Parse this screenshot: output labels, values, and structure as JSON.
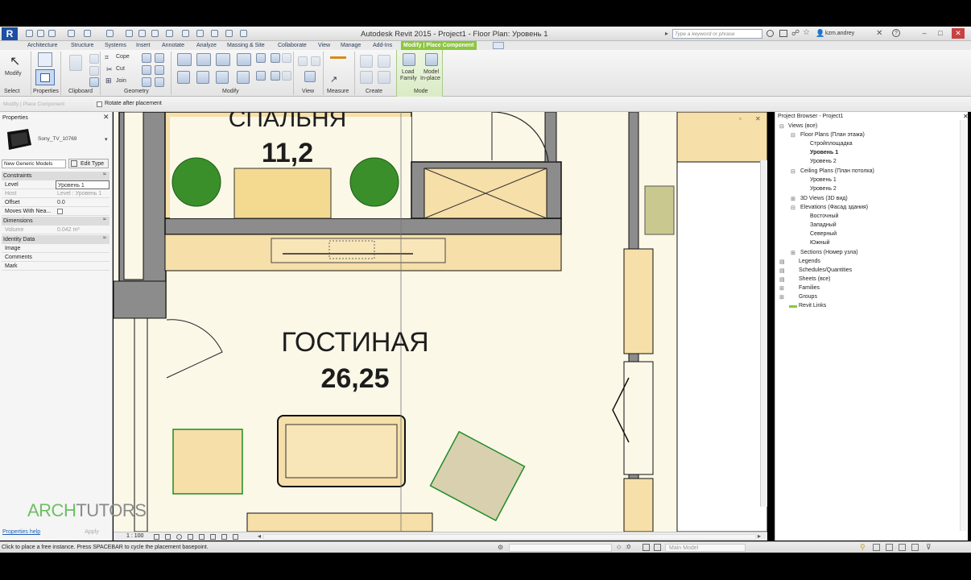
{
  "app": {
    "logo_letter": "R",
    "title": "Autodesk Revit 2015 -   Project1 - Floor Plan: Уровень 1",
    "search_placeholder": "Type a keyword or phrase",
    "user": "kzm.andrey"
  },
  "tabs": [
    "Architecture",
    "Structure",
    "Systems",
    "Insert",
    "Annotate",
    "Analyze",
    "Massing & Site",
    "Collaborate",
    "View",
    "Manage",
    "Add-Ins",
    "Modify | Place Component"
  ],
  "ribbon": {
    "modify_label": "Modify",
    "select_label": "Select",
    "properties_label": "Properties",
    "clipboard_label": "Clipboard",
    "geometry_label": "Geometry",
    "modify_panel_label": "Modify",
    "view_label": "View",
    "measure_label": "Measure",
    "create_label": "Create",
    "mode_label": "Mode",
    "cope": "Cope",
    "cut": "Cut",
    "join": "Join",
    "load_family_1": "Load",
    "load_family_2": "Family",
    "model_inplace_1": "Model",
    "model_inplace_2": "In-place"
  },
  "optionsbar": {
    "context": "Modify | Place Component",
    "rotate_label": "Rotate after placement"
  },
  "properties": {
    "title": "Properties",
    "type_name": "Sony_TV_10769",
    "category": "New Generic Models",
    "edit_type": "Edit Type",
    "constraints": "Constraints",
    "dimensions": "Dimensions",
    "identity": "Identity Data",
    "rows": {
      "level_k": "Level",
      "level_v": "Уровень 1",
      "host_k": "Host",
      "host_v": "Level : Уровень 1",
      "offset_k": "Offset",
      "offset_v": "0.0",
      "moves_k": "Moves With Nea...",
      "volume_k": "Volume",
      "volume_v": "0.042 m³",
      "image_k": "Image",
      "comments_k": "Comments",
      "mark_k": "Mark"
    },
    "help": "Properties help",
    "apply": "Apply"
  },
  "plan": {
    "room1_name": "СПАЛЬНЯ",
    "room1_area": "11,2",
    "room2_name": "ГОСТИНАЯ",
    "room2_area": "26,25"
  },
  "browser": {
    "title": "Project Browser - Project1",
    "views": "Views (все)",
    "floor_plans": "Floor Plans (План этажа)",
    "fp_items": [
      "Стройплощадка",
      "Уровень 1",
      "Уровень 2"
    ],
    "ceiling_plans": "Ceiling Plans (План потолка)",
    "cp_items": [
      "Уровень 1",
      "Уровень 2"
    ],
    "views3d": "3D Views (3D вид)",
    "elevations": "Elevations (Фасад здания)",
    "el_items": [
      "Восточный",
      "Западный",
      "Северный",
      "Южный"
    ],
    "sections": "Sections (Номер узла)",
    "legends": "Legends",
    "schedules": "Schedules/Quantities",
    "sheets": "Sheets (все)",
    "families": "Families",
    "groups": "Groups",
    "links": "Revit Links"
  },
  "viewbar": {
    "scale": "1 : 100"
  },
  "status": {
    "message": "Click to place a free instance. Press SPACEBAR to cycle the placement basepoint.",
    "zero": ":0",
    "model": "Main Model"
  },
  "watermark": {
    "part1": "ARCH",
    "part2": "TUTORS"
  },
  "colors": {
    "accent": "#8cc63f",
    "revit_blue": "#1d4fa3",
    "plan_fill": "#fbf8e8"
  }
}
